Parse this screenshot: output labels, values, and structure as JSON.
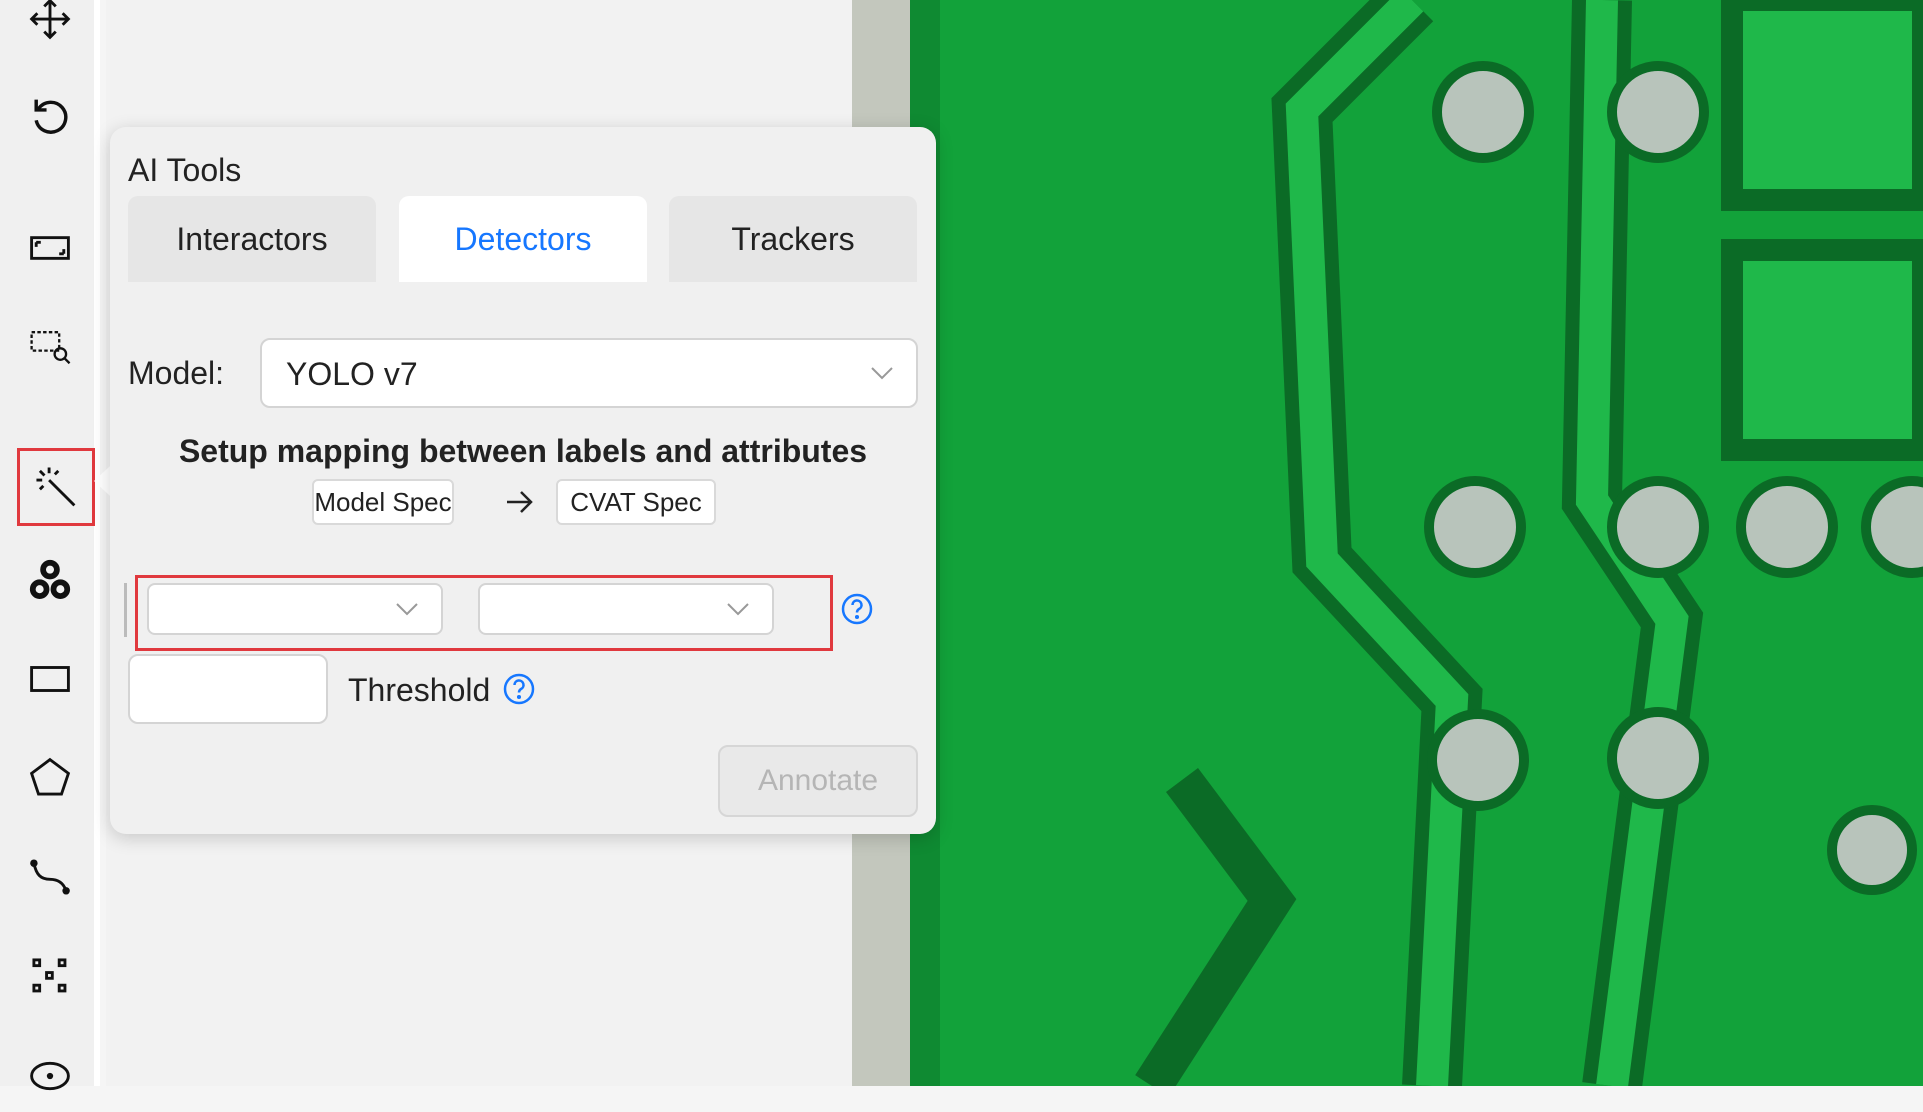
{
  "panel": {
    "title": "AI Tools",
    "tabs": [
      {
        "label": "Interactors"
      },
      {
        "label": "Detectors"
      },
      {
        "label": "Trackers"
      }
    ],
    "active_tab": "Detectors",
    "model": {
      "label": "Model:",
      "value": "YOLO v7"
    },
    "mapping": {
      "title": "Setup mapping between labels and attributes",
      "model_spec": "Model Spec",
      "cvat_spec": "CVAT Spec",
      "model_select_value": "",
      "cvat_select_value": ""
    },
    "threshold": {
      "label": "Threshold",
      "value": ""
    },
    "annotate_label": "Annotate"
  },
  "toolbar": {
    "tools": [
      "move-icon",
      "rotate-icon",
      "fit-image-icon",
      "zoom-region-icon",
      "ai-tools-icon",
      "opencv-icon",
      "rectangle-icon",
      "polygon-icon",
      "polyline-icon",
      "points-icon",
      "ellipse-icon"
    ],
    "active_tool": "ai-tools-icon"
  },
  "colors": {
    "accent": "#1677ff",
    "highlight": "#e0393e",
    "pcb_green": "#12a23a",
    "pcb_trace": "#1fb84a",
    "pcb_dark": "#0b6b26"
  }
}
